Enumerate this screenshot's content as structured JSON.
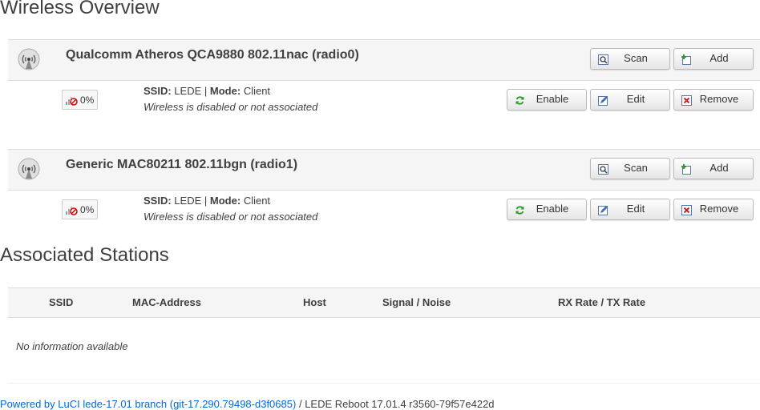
{
  "wireless_overview": {
    "title": "Wireless Overview",
    "radios": [
      {
        "name": "Qualcomm Atheros QCA9880 802.11nac (radio0)",
        "scan_label": "Scan",
        "add_label": "Add",
        "network": {
          "signal": "0%",
          "ssid_label": "SSID:",
          "ssid": "LEDE",
          "separator": "|",
          "mode_label": "Mode:",
          "mode": "Client",
          "status": "Wireless is disabled or not associated",
          "enable_label": "Enable",
          "edit_label": "Edit",
          "remove_label": "Remove"
        }
      },
      {
        "name": "Generic MAC80211 802.11bgn (radio1)",
        "scan_label": "Scan",
        "add_label": "Add",
        "network": {
          "signal": "0%",
          "ssid_label": "SSID:",
          "ssid": "LEDE",
          "separator": "|",
          "mode_label": "Mode:",
          "mode": "Client",
          "status": "Wireless is disabled or not associated",
          "enable_label": "Enable",
          "edit_label": "Edit",
          "remove_label": "Remove"
        }
      }
    ]
  },
  "associated_stations": {
    "title": "Associated Stations",
    "columns": [
      "SSID",
      "MAC-Address",
      "Host",
      "Signal / Noise",
      "RX Rate / TX Rate"
    ],
    "empty_message": "No information available"
  },
  "footer": {
    "link_text": "Powered by LuCI lede-17.01 branch (git-17.290.79498-d3f0685)",
    "separator": "/",
    "version_text": "LEDE Reboot 17.01.4 r3560-79f57e422d"
  },
  "icons": {
    "radio": "wifi-antenna-icon",
    "signal": "signal-disabled-icon",
    "scan": "magnifier-icon",
    "add": "add-icon",
    "enable": "refresh-icon",
    "edit": "edit-icon",
    "remove": "remove-icon"
  },
  "colors": {
    "link": "#0069d6",
    "header_bg": "#f5f5f5",
    "text": "#404040"
  }
}
